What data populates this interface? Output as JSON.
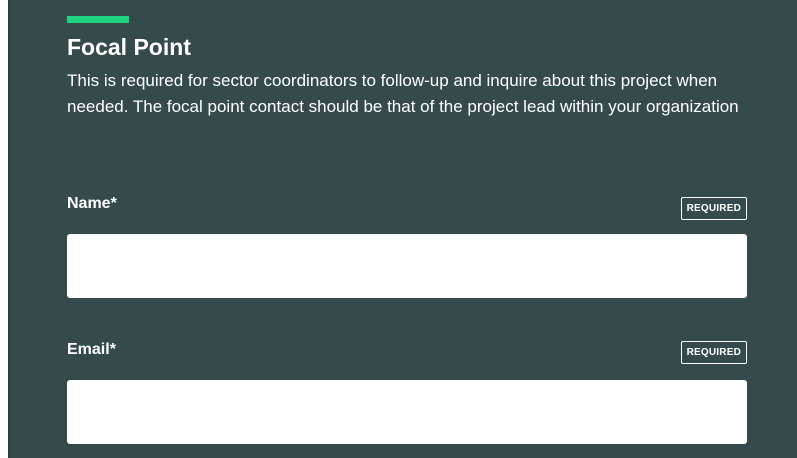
{
  "section": {
    "title": "Focal Point",
    "description": "This is required for sector coordinators to follow-up and inquire about this project when needed. The focal point contact should be that of the project lead within your organization",
    "accent_color": "#1fd37e",
    "background_color": "#344a4b"
  },
  "fields": [
    {
      "label": "Name*",
      "badge": "REQUIRED",
      "value": ""
    },
    {
      "label": "Email*",
      "badge": "REQUIRED",
      "value": ""
    }
  ]
}
